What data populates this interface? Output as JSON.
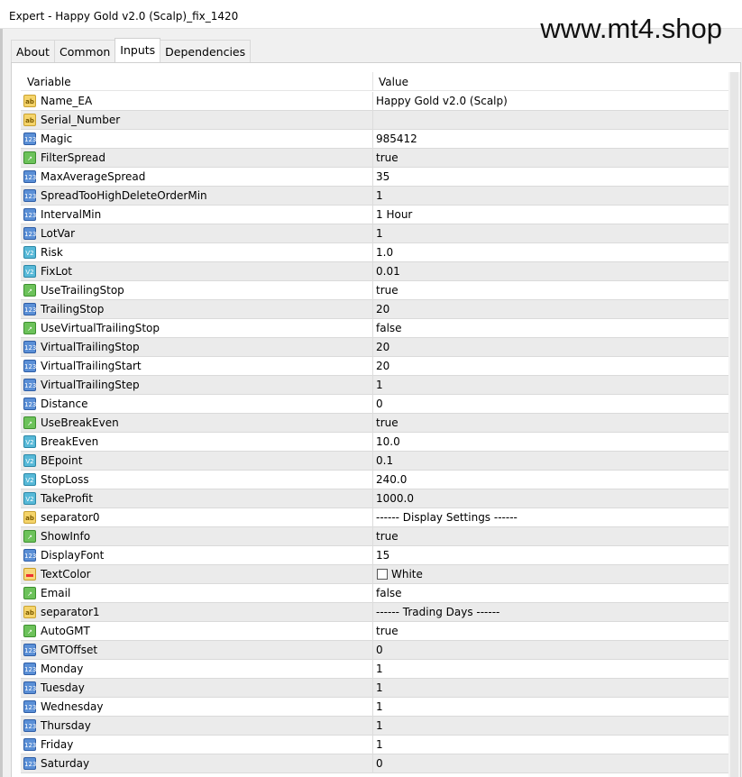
{
  "title": "Expert - Happy Gold v2.0 (Scalp)_fix_1420",
  "watermark": "www.mt4.shop",
  "tabs": [
    "About",
    "Common",
    "Inputs",
    "Dependencies"
  ],
  "active_tab": "Inputs",
  "columns": {
    "variable": "Variable",
    "value": "Value"
  },
  "icon_types": {
    "string": "ab",
    "int": "123",
    "bool": "bool",
    "double": "V2",
    "color": "color"
  },
  "rows": [
    {
      "name": "Name_EA",
      "type": "string",
      "value": "Happy Gold v2.0 (Scalp)"
    },
    {
      "name": "Serial_Number",
      "type": "string",
      "value": ""
    },
    {
      "name": "Magic",
      "type": "int",
      "value": "985412"
    },
    {
      "name": "FilterSpread",
      "type": "bool",
      "value": "true"
    },
    {
      "name": "MaxAverageSpread",
      "type": "int",
      "value": "35"
    },
    {
      "name": "SpreadTooHighDeleteOrderMin",
      "type": "int",
      "value": "1"
    },
    {
      "name": "IntervalMin",
      "type": "int",
      "value": "1 Hour"
    },
    {
      "name": "LotVar",
      "type": "int",
      "value": "1"
    },
    {
      "name": "Risk",
      "type": "double",
      "value": "1.0"
    },
    {
      "name": "FixLot",
      "type": "double",
      "value": "0.01"
    },
    {
      "name": "UseTrailingStop",
      "type": "bool",
      "value": "true"
    },
    {
      "name": "TrailingStop",
      "type": "int",
      "value": "20"
    },
    {
      "name": "UseVirtualTrailingStop",
      "type": "bool",
      "value": "false"
    },
    {
      "name": "VirtualTrailingStop",
      "type": "int",
      "value": "20"
    },
    {
      "name": "VirtualTrailingStart",
      "type": "int",
      "value": "20"
    },
    {
      "name": "VirtualTrailingStep",
      "type": "int",
      "value": "1"
    },
    {
      "name": "Distance",
      "type": "int",
      "value": "0"
    },
    {
      "name": "UseBreakEven",
      "type": "bool",
      "value": "true"
    },
    {
      "name": "BreakEven",
      "type": "double",
      "value": "10.0"
    },
    {
      "name": "BEpoint",
      "type": "double",
      "value": "0.1"
    },
    {
      "name": "StopLoss",
      "type": "double",
      "value": "240.0"
    },
    {
      "name": "TakeProfit",
      "type": "double",
      "value": "1000.0"
    },
    {
      "name": "separator0",
      "type": "string",
      "value": "------ Display Settings ------"
    },
    {
      "name": "ShowInfo",
      "type": "bool",
      "value": "true"
    },
    {
      "name": "DisplayFont",
      "type": "int",
      "value": "15"
    },
    {
      "name": "TextColor",
      "type": "color",
      "value": "White",
      "swatch": "#ffffff"
    },
    {
      "name": "Email",
      "type": "bool",
      "value": "false"
    },
    {
      "name": "separator1",
      "type": "string",
      "value": "------ Trading Days ------"
    },
    {
      "name": "AutoGMT",
      "type": "bool",
      "value": "true"
    },
    {
      "name": "GMTOffset",
      "type": "int",
      "value": "0"
    },
    {
      "name": "Monday",
      "type": "int",
      "value": "1"
    },
    {
      "name": "Tuesday",
      "type": "int",
      "value": "1"
    },
    {
      "name": "Wednesday",
      "type": "int",
      "value": "1"
    },
    {
      "name": "Thursday",
      "type": "int",
      "value": "1"
    },
    {
      "name": "Friday",
      "type": "int",
      "value": "1"
    },
    {
      "name": "Saturday",
      "type": "int",
      "value": "0"
    }
  ]
}
